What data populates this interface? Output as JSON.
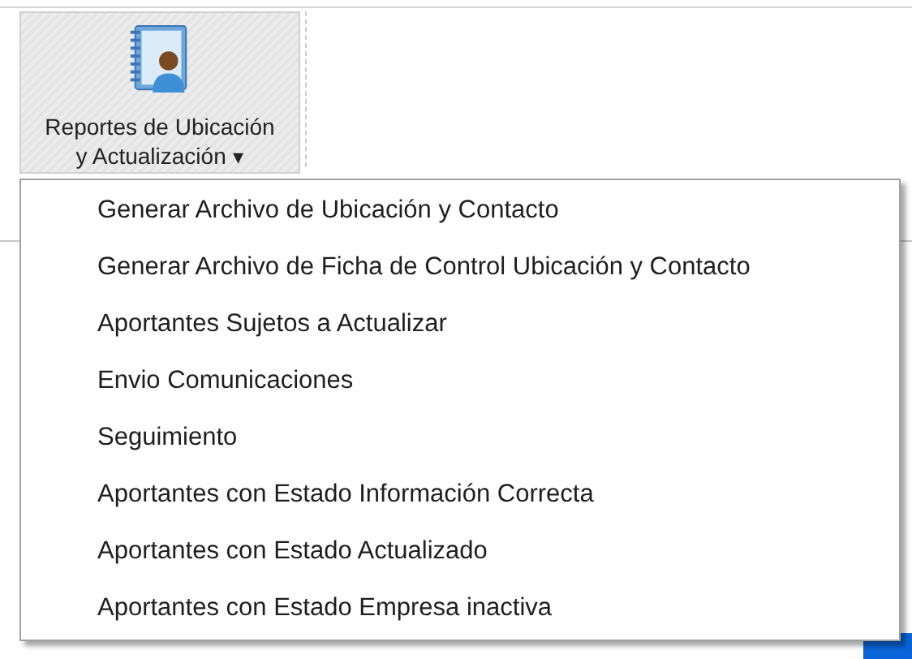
{
  "ribbon_button": {
    "label_line_1": "Reportes de Ubicación",
    "label_line_2": "y Actualización",
    "caret": "▾",
    "expanded": true
  },
  "menu": {
    "items": [
      {
        "label": "Generar Archivo de Ubicación y Contacto"
      },
      {
        "label": "Generar Archivo de Ficha de Control Ubicación y Contacto"
      },
      {
        "label": "Aportantes Sujetos a Actualizar"
      },
      {
        "label": "Envio Comunicaciones"
      },
      {
        "label": "Seguimiento"
      },
      {
        "label": "Aportantes con Estado Información Correcta"
      },
      {
        "label": "Aportantes con Estado Actualizado"
      },
      {
        "label": "Aportantes con Estado Empresa inactiva"
      }
    ]
  }
}
